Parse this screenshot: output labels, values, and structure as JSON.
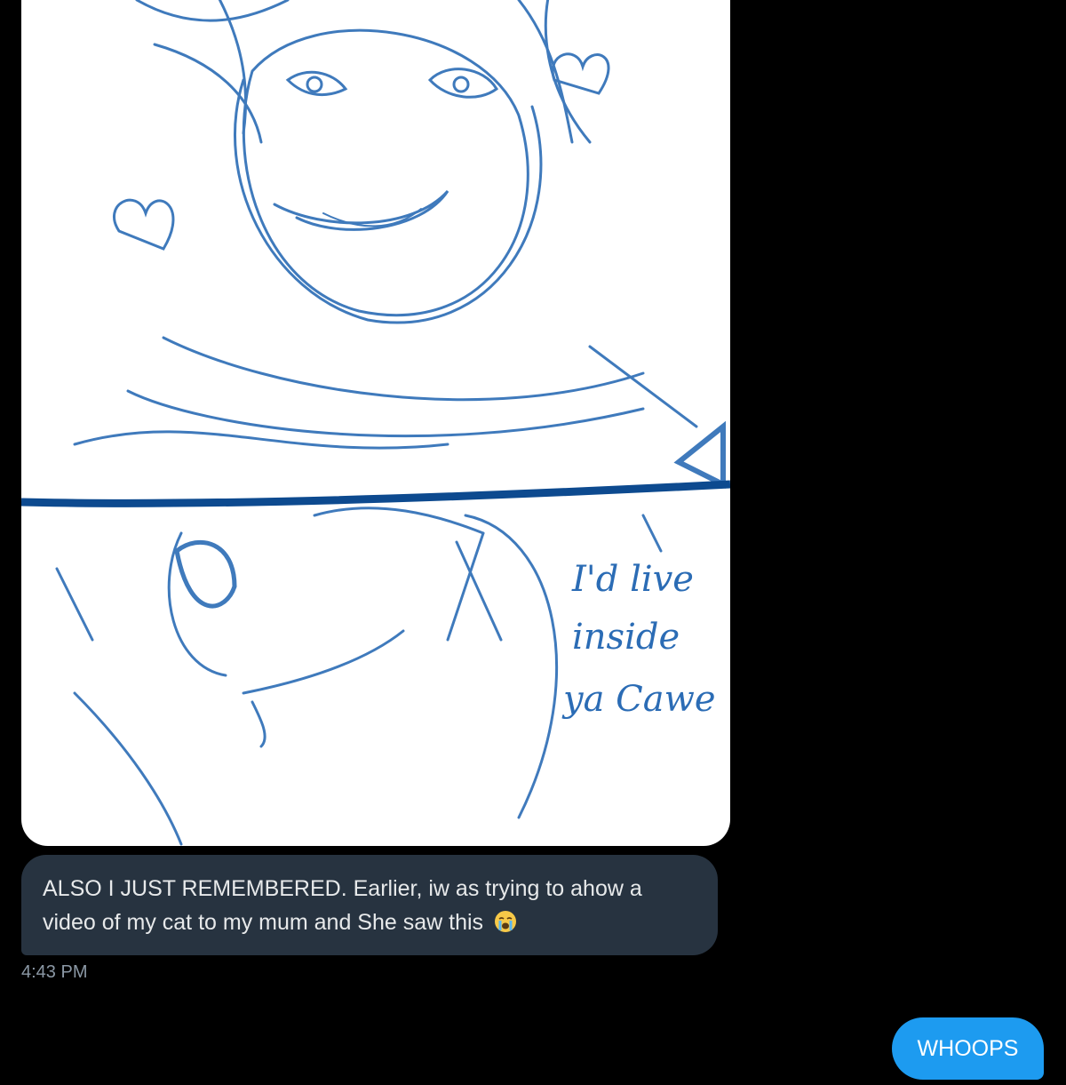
{
  "conversation": {
    "media": {
      "kind": "image",
      "sketch_text_lines": [
        "I'd live",
        "inside",
        "ya Cawe"
      ]
    },
    "received_message": {
      "text": "ALSO I JUST REMEMBERED. Earlier, iw as trying to ahow a video of my cat to my mum and She saw this",
      "emoji": "😭"
    },
    "timestamp": "4:43 PM",
    "sent_message": {
      "text": "WHOOPS"
    }
  },
  "colors": {
    "background": "#000000",
    "incoming_bubble": "#273340",
    "outgoing_bubble": "#1d9bf0",
    "sketch_ink": "#1f5fa8"
  }
}
